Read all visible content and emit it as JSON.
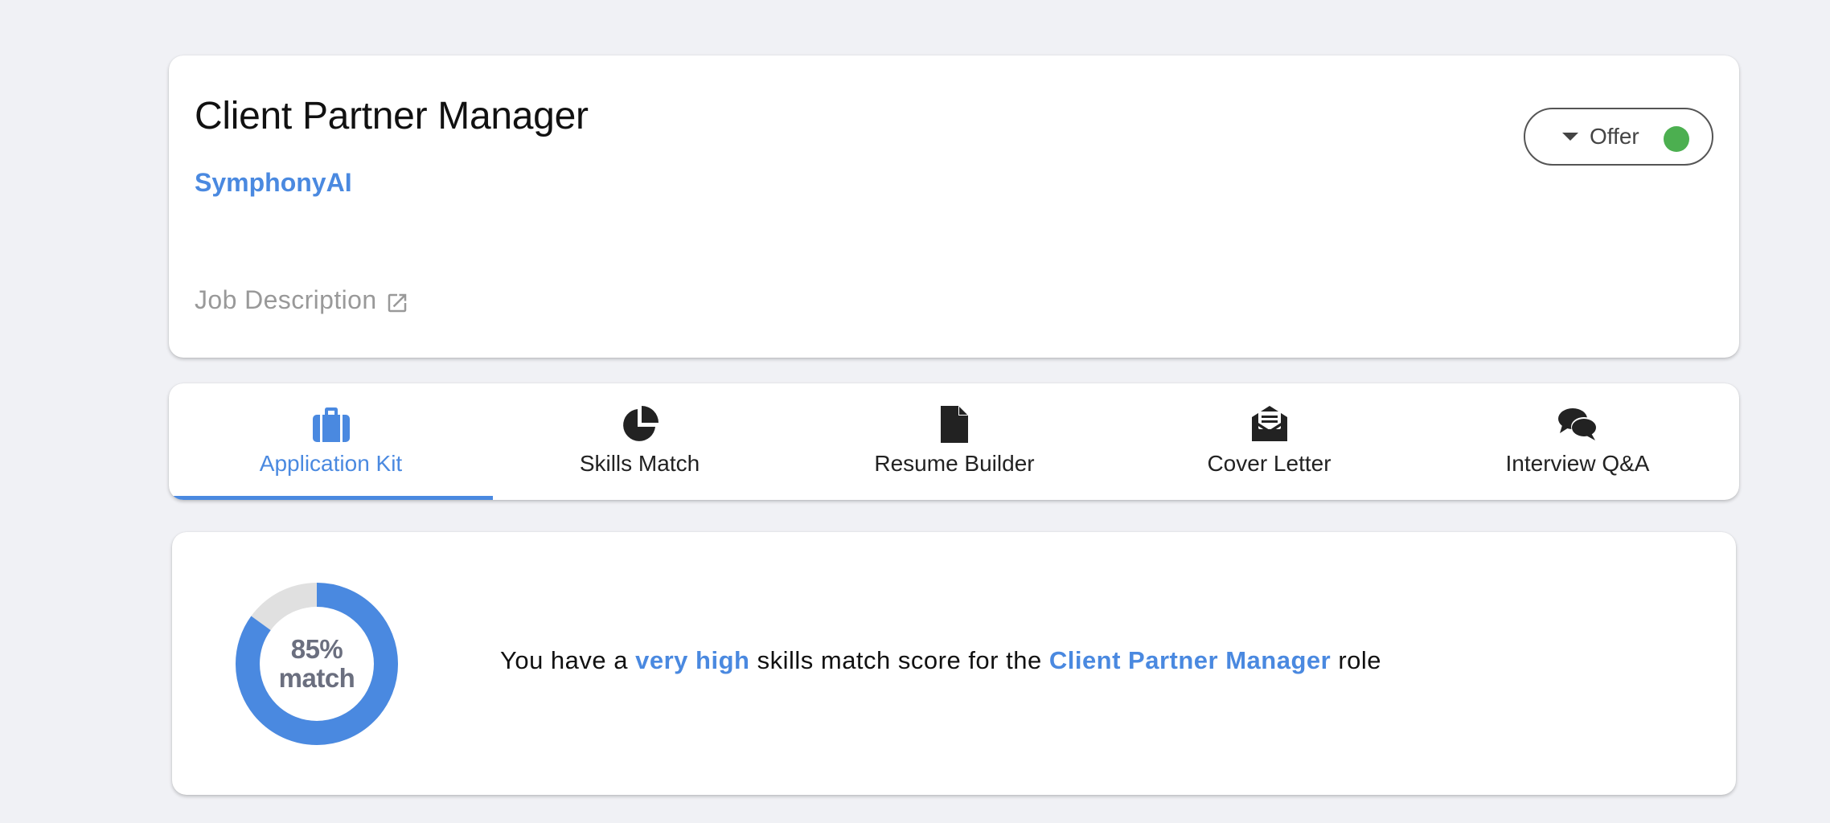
{
  "job": {
    "title": "Client Partner Manager",
    "company": "SymphonyAI",
    "description_link": "Job Description"
  },
  "status": {
    "label": "Offer",
    "color": "#4caf50"
  },
  "tabs": [
    {
      "label": "Application Kit",
      "icon": "briefcase-icon",
      "active": true
    },
    {
      "label": "Skills Match",
      "icon": "pie-chart-icon",
      "active": false
    },
    {
      "label": "Resume Builder",
      "icon": "document-icon",
      "active": false
    },
    {
      "label": "Cover Letter",
      "icon": "envelope-open-icon",
      "active": false
    },
    {
      "label": "Interview Q&A",
      "icon": "chat-bubbles-icon",
      "active": false
    }
  ],
  "match": {
    "percent": 85,
    "percent_label": "85%",
    "match_word": "match",
    "message_prefix": "You have a",
    "level": "very high",
    "message_middle": "skills match score for the",
    "role": "Client Partner Manager",
    "message_suffix": "role"
  },
  "colors": {
    "accent": "#4a89e0",
    "donut_track": "#e0e0e0",
    "background": "#f0f1f5"
  }
}
